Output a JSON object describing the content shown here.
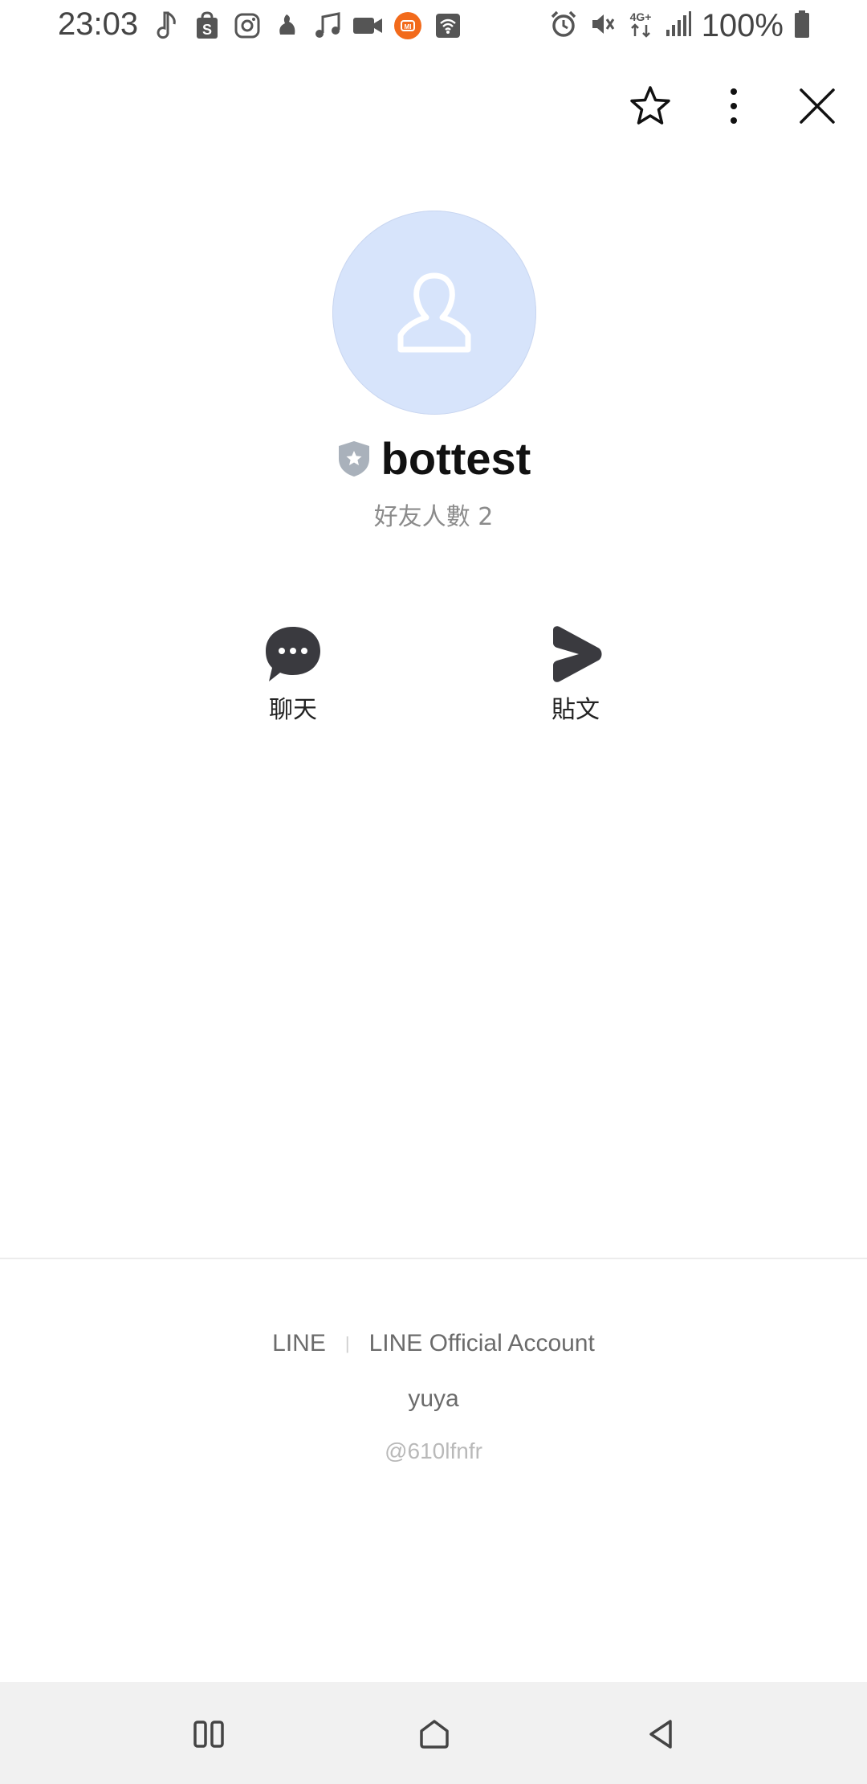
{
  "status_bar": {
    "time": "23:03",
    "battery_text": "100%",
    "left_icons": [
      "music-note-icon",
      "shopee-icon",
      "instagram-icon",
      "bird-app-icon",
      "music-icon",
      "video-camera-icon",
      "mi-icon",
      "wifi-box-icon"
    ],
    "right_icons": [
      "alarm-icon",
      "mute-icon",
      "4g-icon",
      "signal-icon",
      "battery-icon"
    ],
    "network_label": "4G+"
  },
  "header": {
    "favorite_icon": "star-outline-icon",
    "more_icon": "more-vertical-icon",
    "close_icon": "close-icon"
  },
  "profile": {
    "name": "bottest",
    "friends_count": "好友人數 2",
    "badge_icon": "shield-star-icon",
    "avatar_color": "#d7e4fb"
  },
  "actions": {
    "chat_label": "聊天",
    "post_label": "貼文"
  },
  "footer": {
    "link_line": "LINE",
    "link_official": "LINE Official Account",
    "owner": "yuya",
    "account_id": "@610lfnfr"
  },
  "colors": {
    "icon_dark": "#3a3a3f",
    "mi_orange": "#f26a1b"
  }
}
